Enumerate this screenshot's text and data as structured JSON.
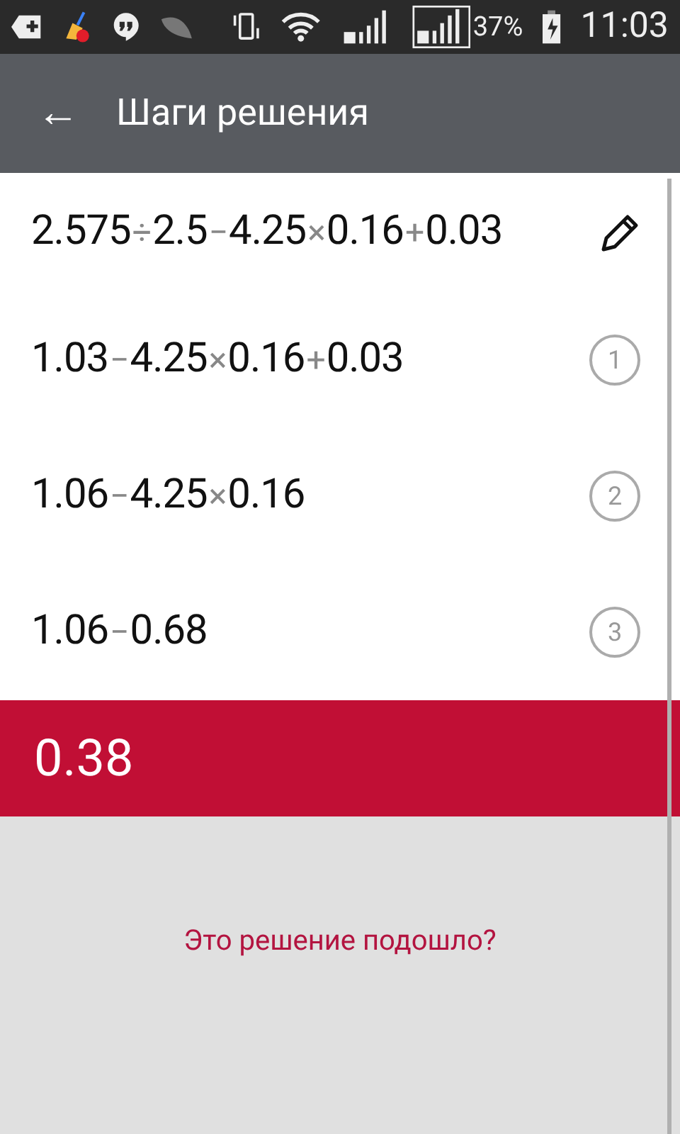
{
  "status_bar": {
    "battery": "37%",
    "time": "11:03"
  },
  "app_bar": {
    "back": "←",
    "title": "Шаги решения"
  },
  "steps": [
    {
      "kind": "input",
      "tokens": [
        {
          "kind": "number",
          "text": "2.575"
        },
        {
          "kind": "operator",
          "text": "÷"
        },
        {
          "kind": "number",
          "text": "2.5"
        },
        {
          "kind": "operator",
          "text": "−"
        },
        {
          "kind": "number",
          "text": "4.25"
        },
        {
          "kind": "operator",
          "text": "×"
        },
        {
          "kind": "number",
          "text": "0.16"
        },
        {
          "kind": "operator",
          "text": "+"
        },
        {
          "kind": "number",
          "text": "0.03"
        }
      ]
    },
    {
      "kind": "step",
      "number": "1",
      "tokens": [
        {
          "kind": "number",
          "text": "1.03"
        },
        {
          "kind": "operator",
          "text": "−"
        },
        {
          "kind": "number",
          "text": "4.25"
        },
        {
          "kind": "operator",
          "text": "×"
        },
        {
          "kind": "number",
          "text": "0.16"
        },
        {
          "kind": "operator",
          "text": "+"
        },
        {
          "kind": "number",
          "text": "0.03"
        }
      ]
    },
    {
      "kind": "step",
      "number": "2",
      "tokens": [
        {
          "kind": "number",
          "text": "1.06"
        },
        {
          "kind": "operator",
          "text": "−"
        },
        {
          "kind": "number",
          "text": "4.25"
        },
        {
          "kind": "operator",
          "text": "×"
        },
        {
          "kind": "number",
          "text": "0.16"
        }
      ]
    },
    {
      "kind": "step",
      "number": "3",
      "tokens": [
        {
          "kind": "number",
          "text": "1.06"
        },
        {
          "kind": "operator",
          "text": "−"
        },
        {
          "kind": "number",
          "text": "0.68"
        }
      ]
    }
  ],
  "result": "0.38",
  "feedback": "Это решение подошло?"
}
